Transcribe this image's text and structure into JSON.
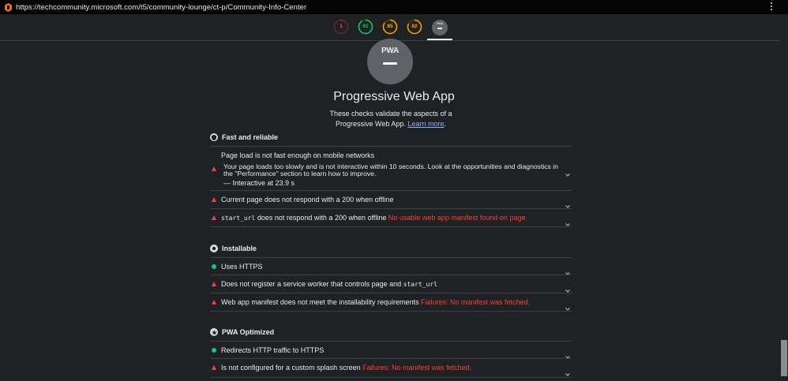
{
  "browser": {
    "url": "https://techcommunity.microsoft.com/t5/community-lounge/ct-p/Community-Info-Center"
  },
  "scores": [
    {
      "label": "1",
      "value": 1,
      "color": "#ff4e42",
      "ring_bg": "#5c2b26"
    },
    {
      "label": "91",
      "value": 91,
      "color": "#0cce6b",
      "ring_bg": "#1e4a34"
    },
    {
      "label": "85",
      "value": 85,
      "color": "#ffa400",
      "ring_bg": "#4d3b12"
    },
    {
      "label": "82",
      "value": 82,
      "color": "#ffa400",
      "ring_bg": "#4d3b12"
    }
  ],
  "pwa_mini": {
    "label": "PWA"
  },
  "pwa_badge": {
    "label": "PWA"
  },
  "category": {
    "title": "Progressive Web App",
    "description": "These checks validate the aspects of a Progressive Web App.",
    "learn_more": "Learn more"
  },
  "sections": {
    "fast": {
      "title": "Fast and reliable",
      "audits": {
        "page_load": {
          "title": "Page load is not fast enough on mobile networks",
          "detail": "Your page loads too slowly and is not interactive within 10 seconds. Look at the opportunities and diagnostics in the \"Performance\" section to learn how to improve.",
          "extra": "— Interactive at 23.9 s"
        },
        "offline": {
          "title": "Current page does not respond with a 200 when offline"
        },
        "start_url": {
          "code": "start_url",
          "title": "does not respond with a 200 when offline",
          "detail": "No usable web app manifest found on page."
        }
      }
    },
    "installable": {
      "title": "Installable",
      "audits": {
        "https": {
          "title": "Uses HTTPS"
        },
        "sw": {
          "title": "Does not register a service worker that controls page and",
          "code": "start_url"
        },
        "manifest": {
          "title": "Web app manifest does not meet the installability requirements",
          "detail": "Failures: No manifest was fetched."
        }
      }
    },
    "optimized": {
      "title": "PWA Optimized",
      "audits": {
        "redirect": {
          "title": "Redirects HTTP traffic to HTTPS"
        },
        "splash": {
          "title": "Is not configured for a custom splash screen",
          "detail": "Failures: No manifest was fetched."
        }
      }
    }
  }
}
